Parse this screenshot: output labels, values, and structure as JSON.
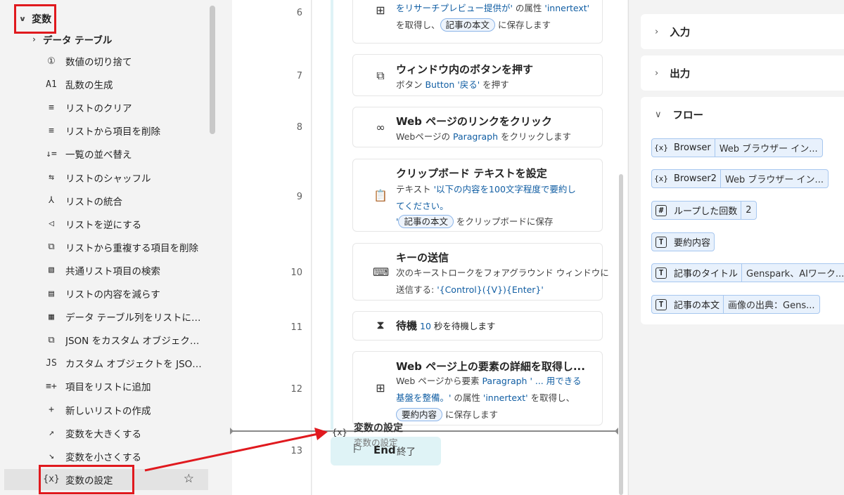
{
  "actions_pane": {
    "category": "変数",
    "subcategory": "データ テーブル",
    "items": [
      {
        "label": "数値の切り捨て",
        "icon": "①"
      },
      {
        "label": "乱数の生成",
        "icon": "A1"
      },
      {
        "label": "リストのクリア",
        "icon": "≡"
      },
      {
        "label": "リストから項目を削除",
        "icon": "≡"
      },
      {
        "label": "一覧の並べ替え",
        "icon": "↓="
      },
      {
        "label": "リストのシャッフル",
        "icon": "⇆"
      },
      {
        "label": "リストの統合",
        "icon": "⅄"
      },
      {
        "label": "リストを逆にする",
        "icon": "◁"
      },
      {
        "label": "リストから重複する項目を削除",
        "icon": "⧉"
      },
      {
        "label": "共通リスト項目の検索",
        "icon": "▧"
      },
      {
        "label": "リストの内容を減らす",
        "icon": "▤"
      },
      {
        "label": "データ テーブル列をリストに取得",
        "icon": "▦"
      },
      {
        "label": "JSON をカスタム オブジェクトに変...",
        "icon": "⧉"
      },
      {
        "label": "カスタム オブジェクトを JSON に...",
        "icon": "JS"
      },
      {
        "label": "項目をリストに追加",
        "icon": "≡+"
      },
      {
        "label": "新しいリストの作成",
        "icon": "+"
      },
      {
        "label": "変数を大きくする",
        "icon": "↗"
      },
      {
        "label": "変数を小さくする",
        "icon": "↘"
      },
      {
        "label": "変数の設定",
        "icon": "{x}"
      }
    ]
  },
  "flow": {
    "steps": [
      {
        "line": "6",
        "title": "",
        "lines": [
          [
            {
              "t": "をリサーチプレビュー提供が'",
              "c": "blue"
            },
            {
              "t": " の属性 "
            },
            {
              "t": "'innertext'",
              "c": "blue"
            }
          ],
          [
            {
              "t": "を取得し、"
            },
            {
              "t": "記事の本文",
              "c": "pill"
            },
            {
              "t": " に保存します"
            }
          ]
        ]
      },
      {
        "line": "7",
        "title": "ウィンドウ内のボタンを押す",
        "lines": [
          [
            {
              "t": "ボタン "
            },
            {
              "t": "Button '戻る'",
              "c": "blue"
            },
            {
              "t": " を押す"
            }
          ]
        ]
      },
      {
        "line": "8",
        "title": "Web ページのリンクをクリック",
        "lines": [
          [
            {
              "t": "Webページの "
            },
            {
              "t": "Paragraph",
              "c": "blue"
            },
            {
              "t": " をクリックします"
            }
          ]
        ]
      },
      {
        "line": "9",
        "title": "クリップボード テキストを設定",
        "lines": [
          [
            {
              "t": "テキスト "
            },
            {
              "t": "'以下の内容を100文字程度で要約し",
              "c": "blue"
            }
          ],
          [
            {
              "t": "てください。",
              "c": "blue"
            }
          ],
          [
            {
              "t": "'",
              "c": "blue"
            },
            {
              "t": "記事の本文",
              "c": "pill"
            },
            {
              "t": " をクリップボードに保存"
            }
          ]
        ]
      },
      {
        "line": "10",
        "title": "キーの送信",
        "lines": [
          [
            {
              "t": "次のキーストロークをフォアグラウンド ウィンドウに"
            }
          ],
          [
            {
              "t": "送信する: "
            },
            {
              "t": "'{Control}({V}){Enter}'",
              "c": "blue"
            }
          ]
        ]
      },
      {
        "line": "11",
        "title": "待機",
        "inline": [
          {
            "t": " 10",
            "c": "blue"
          },
          {
            "t": " 秒を待機します"
          }
        ],
        "lines": []
      },
      {
        "line": "12",
        "title": "Web ページ上の要素の詳細を取得し...",
        "lines": [
          [
            {
              "t": "Web ページから要素 "
            },
            {
              "t": "Paragraph ' ... 用できる",
              "c": "blue"
            }
          ],
          [
            {
              "t": "基盤を整備。'",
              "c": "blue"
            },
            {
              "t": " の属性 "
            },
            {
              "t": "'innertext'",
              "c": "blue"
            },
            {
              "t": " を取得し、"
            }
          ],
          [
            {
              "t": "要約内容",
              "c": "pill"
            },
            {
              "t": " に保存します"
            }
          ]
        ]
      }
    ],
    "end": {
      "line": "13",
      "title": "End",
      "subtitle": "終了"
    },
    "drag_ghost": {
      "icon": "{x}",
      "title": "変数の設定",
      "subtitle": "変数の設定"
    }
  },
  "variables_pane": {
    "input_label": "入力",
    "output_label": "出力",
    "flow_label": "フロー",
    "flow_vars": [
      {
        "icon": "{x}",
        "name": "Browser",
        "value": "Web ブラウザー イン..."
      },
      {
        "icon": "{x}",
        "name": "Browser2",
        "value": "Web ブラウザー イン..."
      },
      {
        "icon": "#",
        "name": "ループした回数",
        "value": "2"
      },
      {
        "icon": "T",
        "name": "要約内容",
        "value": ""
      },
      {
        "icon": "T",
        "name": "記事のタイトル",
        "value": "Genspark、AIワーク..."
      },
      {
        "icon": "T",
        "name": "記事の本文",
        "value": "画像の出典：Gens..."
      }
    ]
  },
  "colors": {
    "highlight": "#e0191e",
    "link_blue": "#115ea3",
    "loop_bar": "#dff3f6",
    "chip_bg": "#e8f1fc"
  }
}
